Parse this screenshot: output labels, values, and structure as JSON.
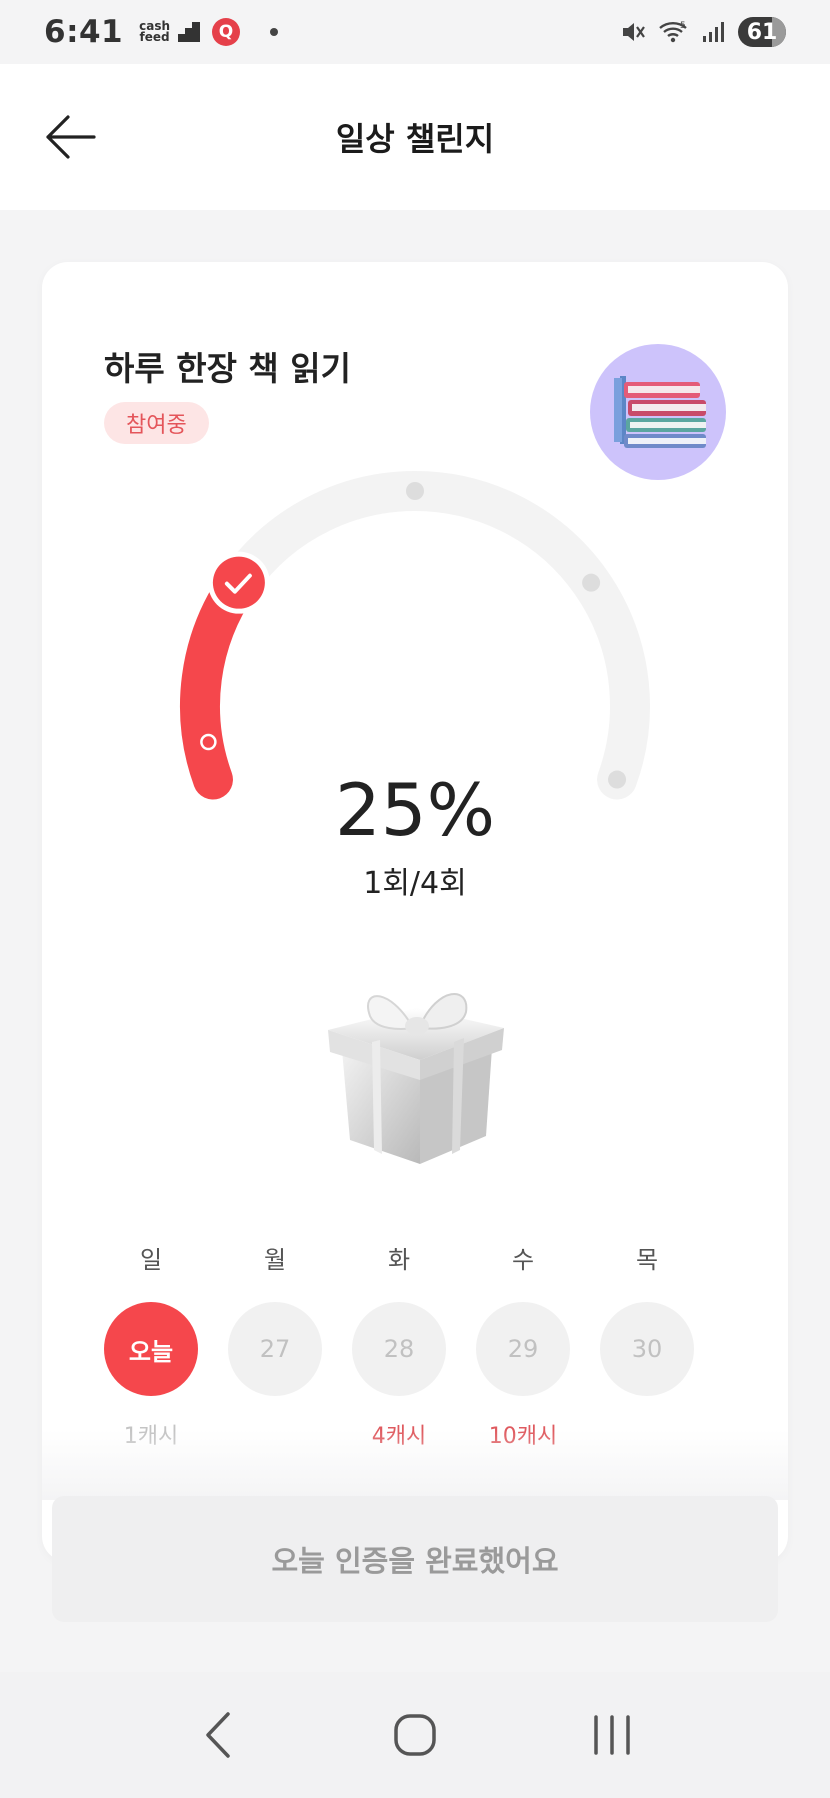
{
  "status_bar": {
    "time": "6:41",
    "battery": "61",
    "cashfeed_line1": "cash",
    "cashfeed_line2": "feed",
    "q_icon_text": "Q",
    "network_label": "5"
  },
  "header": {
    "title": "일상 챌린지",
    "back_icon": "arrow-left-icon"
  },
  "challenge": {
    "title": "하루 한장 책 읽기",
    "status": "참여중",
    "icon": "books-icon",
    "progress_percent": 25,
    "percent_text": "25%",
    "count_text": "1회/4회",
    "completed": 1,
    "total": 4
  },
  "days": [
    {
      "label": "일",
      "value": "오늘",
      "today": true,
      "reward": "1캐시",
      "reward_style": "muted"
    },
    {
      "label": "월",
      "value": "27",
      "today": false,
      "reward": "",
      "reward_style": ""
    },
    {
      "label": "화",
      "value": "28",
      "today": false,
      "reward": "4캐시",
      "reward_style": "red"
    },
    {
      "label": "수",
      "value": "29",
      "today": false,
      "reward": "10캐시",
      "reward_style": "red"
    },
    {
      "label": "목",
      "value": "30",
      "today": false,
      "reward": "",
      "reward_style": ""
    }
  ],
  "complete_button": {
    "label": "오늘 인증을 완료했어요"
  },
  "nav": {
    "back": "nav-back-icon",
    "home": "nav-home-icon",
    "recents": "nav-recents-icon"
  },
  "colors": {
    "accent": "#f5474c",
    "badge_bg": "#fde5e5",
    "track": "#f3f3f3",
    "avatar_bg": "#cdc3fb"
  }
}
